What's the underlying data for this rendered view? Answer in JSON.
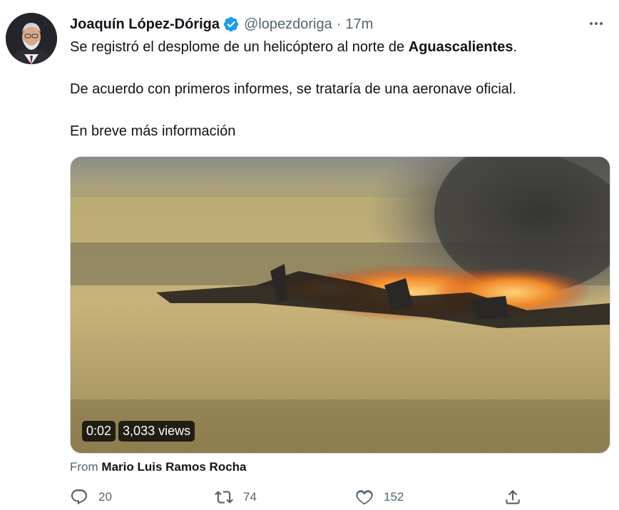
{
  "tweet": {
    "author_name": "Joaquín López-Dóriga",
    "handle": "@lopezdoriga",
    "separator": "·",
    "time": "17m",
    "paragraph1_prefix": "Se registró el desplome de un helicóptero al norte de ",
    "paragraph1_bold": "Aguascalientes",
    "paragraph1_suffix": ".",
    "paragraph2": "De acuerdo con primeros informes, se trataría de una aeronave oficial.",
    "paragraph3": "En breve más información"
  },
  "video": {
    "duration": "0:02",
    "views": "3,033 views"
  },
  "attribution": {
    "prefix": "From",
    "source": "Mario Luis Ramos Rocha"
  },
  "actions": {
    "replies": "20",
    "retweets": "74",
    "likes": "152"
  },
  "colors": {
    "verified": "#1d9bf0",
    "secondary_text": "#536471",
    "primary_text": "#0f1419"
  },
  "icons": [
    "verified-badge-icon",
    "more-icon",
    "reply-icon",
    "retweet-icon",
    "like-icon",
    "share-icon"
  ]
}
